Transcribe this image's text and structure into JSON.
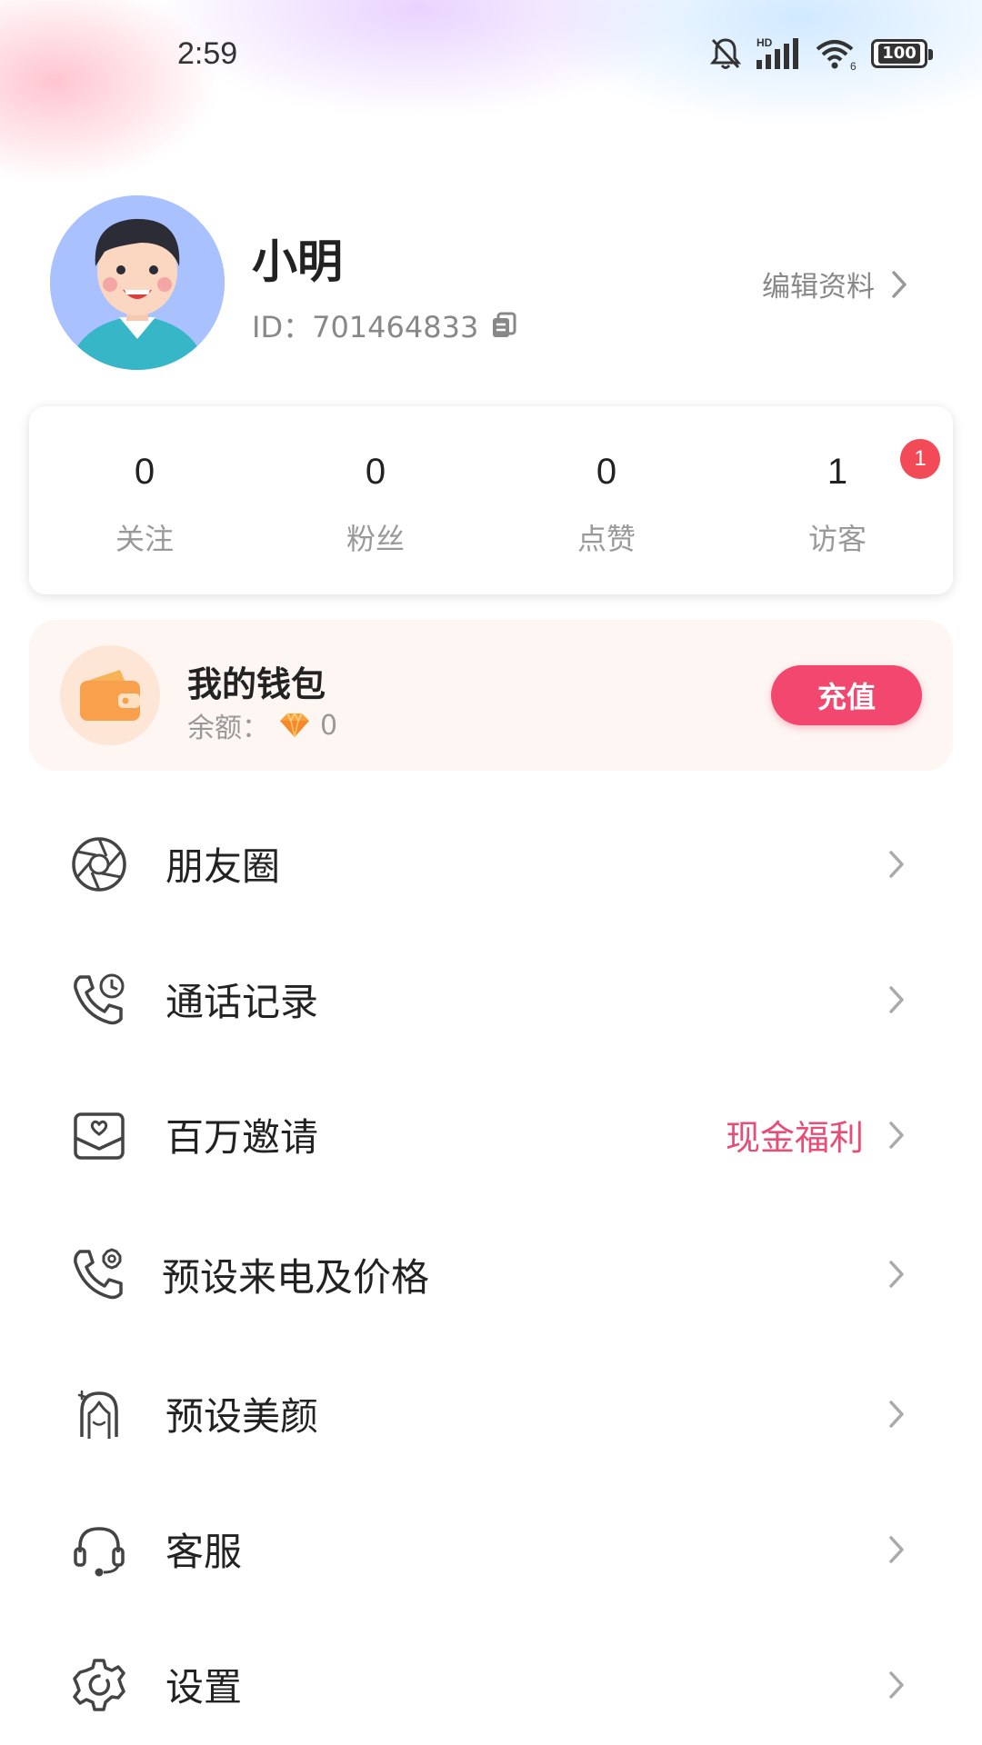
{
  "status_bar": {
    "time": "2:59",
    "network_label": "HD",
    "wifi_label": "6",
    "battery": "100"
  },
  "profile": {
    "name": "小明",
    "id_text": "ID：701464833",
    "edit_label": "编辑资料"
  },
  "stats": [
    {
      "value": "0",
      "label": "关注"
    },
    {
      "value": "0",
      "label": "粉丝"
    },
    {
      "value": "0",
      "label": "点赞"
    },
    {
      "value": "1",
      "label": "访客",
      "badge": "1"
    }
  ],
  "wallet": {
    "title": "我的钱包",
    "balance_label": "余额：",
    "balance_value": "0",
    "recharge_label": "充值"
  },
  "menu": [
    {
      "label": "朋友圈",
      "icon": "aperture-icon"
    },
    {
      "label": "通话记录",
      "icon": "phone-clock-icon"
    },
    {
      "label": "百万邀请",
      "icon": "invite-envelope-icon",
      "extra": "现金福利"
    },
    {
      "label": "预设来电及价格",
      "icon": "phone-settings-icon"
    },
    {
      "label": "预设美颜",
      "icon": "beauty-face-icon"
    },
    {
      "label": "客服",
      "icon": "headset-icon"
    },
    {
      "label": "设置",
      "icon": "settings-gear-icon"
    }
  ],
  "colors": {
    "accent": "#f2476e",
    "badge": "#f24a56",
    "extra_text": "#e84d77"
  }
}
